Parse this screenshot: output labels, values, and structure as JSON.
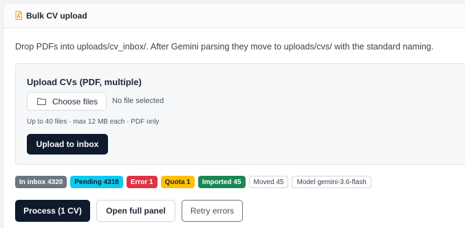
{
  "header": {
    "title": "Bulk CV upload",
    "icon": "pdf-file-icon"
  },
  "description": "Drop PDFs into uploads/cv_inbox/. After Gemini parsing they move to uploads/cvs/ with the standard naming.",
  "upload": {
    "label": "Upload CVs (PDF, multiple)",
    "choose_button": "Choose files",
    "folder_icon": "folder-icon",
    "no_file_text": "No file selected",
    "hint": "Up to 40 files · max 12 MB each · PDF only",
    "upload_button": "Upload to inbox"
  },
  "badges": {
    "inbox": "In inbox 4320",
    "pending": "Pending 4318",
    "error": "Error 1",
    "quota": "Quota 1",
    "imported": "Imported 45",
    "moved": "Moved 45",
    "model": "Model gemini-3.6-flash"
  },
  "actions": {
    "process": "Process (1 CV)",
    "open_panel": "Open full panel",
    "retry": "Retry errors"
  },
  "colors": {
    "primary": "#0f1b2d",
    "inbox_badge": "#6c757d",
    "pending_badge": "#0dcaf0",
    "error_badge": "#dc3545",
    "quota_badge": "#ffc107",
    "imported_badge": "#198754"
  }
}
